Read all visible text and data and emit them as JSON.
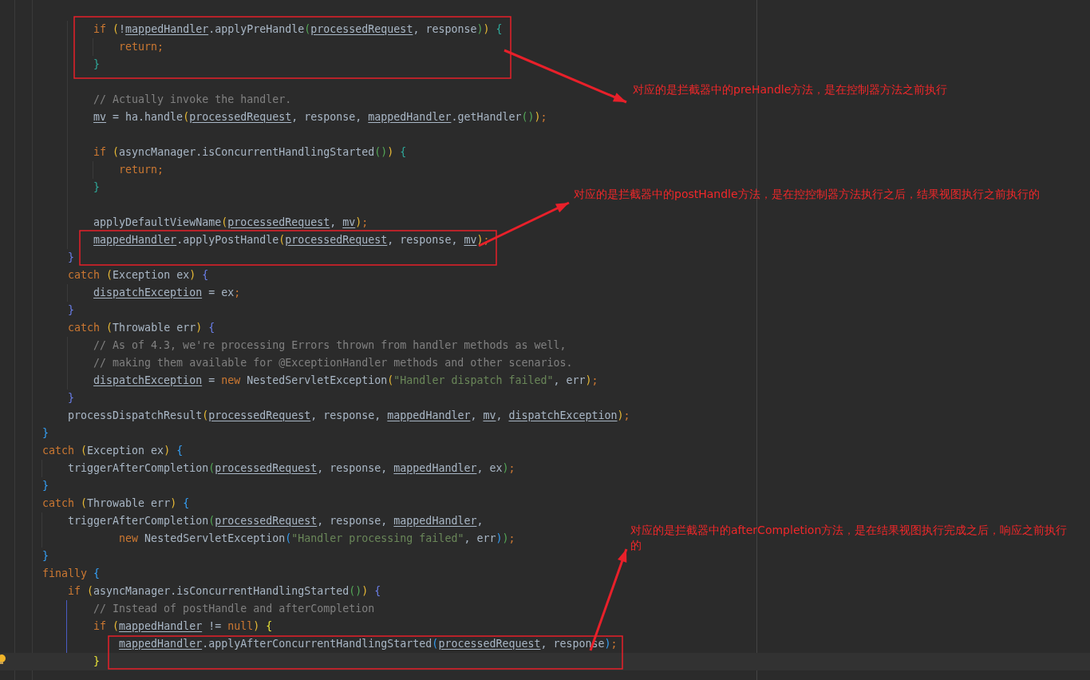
{
  "editor": {
    "lines": [
      {
        "tokens": [
          {
            "text": "        if ",
            "kind": "keyword"
          },
          {
            "text": "(",
            "kind": "bracket1"
          },
          {
            "text": "!",
            "kind": "text"
          },
          {
            "text": "mappedHandler",
            "kind": "field"
          },
          {
            "text": ".applyPreHandle",
            "kind": "text"
          },
          {
            "text": "(",
            "kind": "bracket2"
          },
          {
            "text": "processedRequest",
            "kind": "field"
          },
          {
            "text": ", response",
            "kind": "text"
          },
          {
            "text": ")",
            "kind": "bracket2"
          },
          {
            "text": ") ",
            "kind": "bracket1"
          },
          {
            "text": "{",
            "kind": "bracket4"
          }
        ]
      },
      {
        "tokens": [
          {
            "text": "            return;",
            "kind": "keyword"
          }
        ]
      },
      {
        "tokens": [
          {
            "text": "        }",
            "kind": "bracket4"
          }
        ]
      },
      {
        "blank": true
      },
      {
        "tokens": [
          {
            "text": "        // Actually invoke the handler.",
            "kind": "comment"
          }
        ]
      },
      {
        "tokens": [
          {
            "text": "        mv",
            "kind": "field"
          },
          {
            "text": " = ha.handle",
            "kind": "text"
          },
          {
            "text": "(",
            "kind": "bracket1"
          },
          {
            "text": "processedRequest",
            "kind": "field"
          },
          {
            "text": ", response, ",
            "kind": "text"
          },
          {
            "text": "mappedHandler",
            "kind": "field"
          },
          {
            "text": ".getHandler",
            "kind": "text"
          },
          {
            "text": "()",
            "kind": "bracket2"
          },
          {
            "text": ")",
            "kind": "bracket1"
          },
          {
            "text": ";",
            "kind": "keyword"
          }
        ]
      },
      {
        "blank": true
      },
      {
        "tokens": [
          {
            "text": "        if ",
            "kind": "keyword"
          },
          {
            "text": "(",
            "kind": "bracket1"
          },
          {
            "text": "asyncManager.isConcurrentHandlingStarted",
            "kind": "text"
          },
          {
            "text": "()",
            "kind": "bracket2"
          },
          {
            "text": ") ",
            "kind": "bracket1"
          },
          {
            "text": "{",
            "kind": "bracket4"
          }
        ]
      },
      {
        "tokens": [
          {
            "text": "            return;",
            "kind": "keyword"
          }
        ]
      },
      {
        "tokens": [
          {
            "text": "        }",
            "kind": "bracket4"
          }
        ]
      },
      {
        "blank": true
      },
      {
        "tokens": [
          {
            "text": "        applyDefaultViewName",
            "kind": "text"
          },
          {
            "text": "(",
            "kind": "bracket1"
          },
          {
            "text": "processedRequest",
            "kind": "field"
          },
          {
            "text": ", ",
            "kind": "text"
          },
          {
            "text": "mv",
            "kind": "field"
          },
          {
            "text": ")",
            "kind": "bracket1"
          },
          {
            "text": ";",
            "kind": "keyword"
          }
        ]
      },
      {
        "tokens": [
          {
            "text": "        mappedHandler",
            "kind": "field"
          },
          {
            "text": ".applyPostHandle",
            "kind": "text"
          },
          {
            "text": "(",
            "kind": "bracket1"
          },
          {
            "text": "processedRequest",
            "kind": "field"
          },
          {
            "text": ", response, ",
            "kind": "text"
          },
          {
            "text": "mv",
            "kind": "field"
          },
          {
            "text": ")",
            "kind": "bracket1"
          },
          {
            "text": ";",
            "kind": "keyword"
          }
        ]
      },
      {
        "tokens": [
          {
            "text": "    }",
            "kind": "bracket5"
          }
        ]
      },
      {
        "tokens": [
          {
            "text": "    catch ",
            "kind": "keyword"
          },
          {
            "text": "(",
            "kind": "bracket1"
          },
          {
            "text": "Exception ex",
            "kind": "text"
          },
          {
            "text": ") ",
            "kind": "bracket1"
          },
          {
            "text": "{",
            "kind": "bracket5"
          }
        ]
      },
      {
        "tokens": [
          {
            "text": "        dispatchException",
            "kind": "field"
          },
          {
            "text": " = ex",
            "kind": "text"
          },
          {
            "text": ";",
            "kind": "keyword"
          }
        ]
      },
      {
        "tokens": [
          {
            "text": "    }",
            "kind": "bracket5"
          }
        ]
      },
      {
        "tokens": [
          {
            "text": "    catch ",
            "kind": "keyword"
          },
          {
            "text": "(",
            "kind": "bracket1"
          },
          {
            "text": "Throwable err",
            "kind": "text"
          },
          {
            "text": ") ",
            "kind": "bracket1"
          },
          {
            "text": "{",
            "kind": "bracket5"
          }
        ]
      },
      {
        "tokens": [
          {
            "text": "        // As of 4.3, we're processing Errors thrown from handler methods as well,",
            "kind": "comment"
          }
        ]
      },
      {
        "tokens": [
          {
            "text": "        // making them available for @ExceptionHandler methods and other scenarios.",
            "kind": "comment"
          }
        ]
      },
      {
        "tokens": [
          {
            "text": "        dispatchException",
            "kind": "field"
          },
          {
            "text": " = ",
            "kind": "text"
          },
          {
            "text": "new",
            "kind": "keyword"
          },
          {
            "text": " NestedServletException",
            "kind": "text"
          },
          {
            "text": "(",
            "kind": "bracket1"
          },
          {
            "text": "\"Handler dispatch failed\"",
            "kind": "string"
          },
          {
            "text": ", err",
            "kind": "text"
          },
          {
            "text": ")",
            "kind": "bracket1"
          },
          {
            "text": ";",
            "kind": "keyword"
          }
        ]
      },
      {
        "tokens": [
          {
            "text": "    }",
            "kind": "bracket5"
          }
        ]
      },
      {
        "tokens": [
          {
            "text": "    processDispatchResult",
            "kind": "text"
          },
          {
            "text": "(",
            "kind": "bracket1"
          },
          {
            "text": "processedRequest",
            "kind": "field"
          },
          {
            "text": ", response, ",
            "kind": "text"
          },
          {
            "text": "mappedHandler",
            "kind": "field"
          },
          {
            "text": ", ",
            "kind": "text"
          },
          {
            "text": "mv",
            "kind": "field"
          },
          {
            "text": ", ",
            "kind": "text"
          },
          {
            "text": "dispatchException",
            "kind": "field"
          },
          {
            "text": ")",
            "kind": "bracket1"
          },
          {
            "text": ";",
            "kind": "keyword"
          }
        ]
      },
      {
        "tokens": [
          {
            "text": "}",
            "kind": "bracket3"
          }
        ]
      },
      {
        "tokens": [
          {
            "text": "catch ",
            "kind": "keyword"
          },
          {
            "text": "(",
            "kind": "bracket1"
          },
          {
            "text": "Exception ex",
            "kind": "text"
          },
          {
            "text": ") ",
            "kind": "bracket1"
          },
          {
            "text": "{",
            "kind": "bracket3"
          }
        ]
      },
      {
        "tokens": [
          {
            "text": "    triggerAfterCompletion",
            "kind": "text"
          },
          {
            "text": "(",
            "kind": "bracket2"
          },
          {
            "text": "processedRequest",
            "kind": "field"
          },
          {
            "text": ", response, ",
            "kind": "text"
          },
          {
            "text": "mappedHandler",
            "kind": "field"
          },
          {
            "text": ", ex",
            "kind": "text"
          },
          {
            "text": ")",
            "kind": "bracket2"
          },
          {
            "text": ";",
            "kind": "keyword"
          }
        ]
      },
      {
        "tokens": [
          {
            "text": "}",
            "kind": "bracket3"
          }
        ]
      },
      {
        "tokens": [
          {
            "text": "catch ",
            "kind": "keyword"
          },
          {
            "text": "(",
            "kind": "bracket1"
          },
          {
            "text": "Throwable err",
            "kind": "text"
          },
          {
            "text": ") ",
            "kind": "bracket1"
          },
          {
            "text": "{",
            "kind": "bracket3"
          }
        ]
      },
      {
        "tokens": [
          {
            "text": "    triggerAfterCompletion",
            "kind": "text"
          },
          {
            "text": "(",
            "kind": "bracket2"
          },
          {
            "text": "processedRequest",
            "kind": "field"
          },
          {
            "text": ", response, ",
            "kind": "text"
          },
          {
            "text": "mappedHandler",
            "kind": "field"
          },
          {
            "text": ",",
            "kind": "text"
          }
        ]
      },
      {
        "tokens": [
          {
            "text": "            new",
            "kind": "keyword"
          },
          {
            "text": " NestedServletException",
            "kind": "text"
          },
          {
            "text": "(",
            "kind": "bracket3"
          },
          {
            "text": "\"Handler processing failed\"",
            "kind": "string"
          },
          {
            "text": ", err",
            "kind": "text"
          },
          {
            "text": ")",
            "kind": "bracket3"
          },
          {
            "text": ")",
            "kind": "bracket2"
          },
          {
            "text": ";",
            "kind": "keyword"
          }
        ]
      },
      {
        "tokens": [
          {
            "text": "}",
            "kind": "bracket3"
          }
        ]
      },
      {
        "tokens": [
          {
            "text": "finally ",
            "kind": "keyword"
          },
          {
            "text": "{",
            "kind": "bracket3"
          }
        ]
      },
      {
        "tokens": [
          {
            "text": "    if ",
            "kind": "keyword"
          },
          {
            "text": "(",
            "kind": "bracket1"
          },
          {
            "text": "asyncManager.isConcurrentHandlingStarted",
            "kind": "text"
          },
          {
            "text": "()",
            "kind": "bracket2"
          },
          {
            "text": ") ",
            "kind": "bracket1"
          },
          {
            "text": "{",
            "kind": "bracket5"
          }
        ]
      },
      {
        "tokens": [
          {
            "text": "        // Instead of postHandle and afterCompletion",
            "kind": "comment"
          }
        ]
      },
      {
        "tokens": [
          {
            "text": "        if ",
            "kind": "keyword"
          },
          {
            "text": "(",
            "kind": "bracket1"
          },
          {
            "text": "mappedHandler",
            "kind": "field"
          },
          {
            "text": " != ",
            "kind": "text"
          },
          {
            "text": "null",
            "kind": "keyword"
          },
          {
            "text": ") ",
            "kind": "bracket1"
          },
          {
            "text": "{",
            "kind": "bracket6"
          }
        ]
      },
      {
        "tokens": [
          {
            "text": "            mappedHandler",
            "kind": "field"
          },
          {
            "text": ".applyAfterConcurrentHandlingStarted",
            "kind": "text"
          },
          {
            "text": "(",
            "kind": "bracket3"
          },
          {
            "text": "processedRequest",
            "kind": "field"
          },
          {
            "text": ", response",
            "kind": "text"
          },
          {
            "text": ")",
            "kind": "bracket3"
          },
          {
            "text": ";",
            "kind": "keyword"
          }
        ]
      },
      {
        "tokens": [
          {
            "text": "        }",
            "kind": "bracket6"
          }
        ],
        "current": true
      }
    ]
  },
  "annotations": [
    {
      "text": "对应的是拦截器中的preHandle方法，是在控制器方法之前执行"
    },
    {
      "text": "对应的是拦截器中的postHandle方法，是在控控制器方法执行之后，结果视图执行之前执行的"
    },
    {
      "text": "对应的是拦截器中的afterCompletion方法，是在结果视图执行完成之后，响应之前执行的"
    }
  ]
}
